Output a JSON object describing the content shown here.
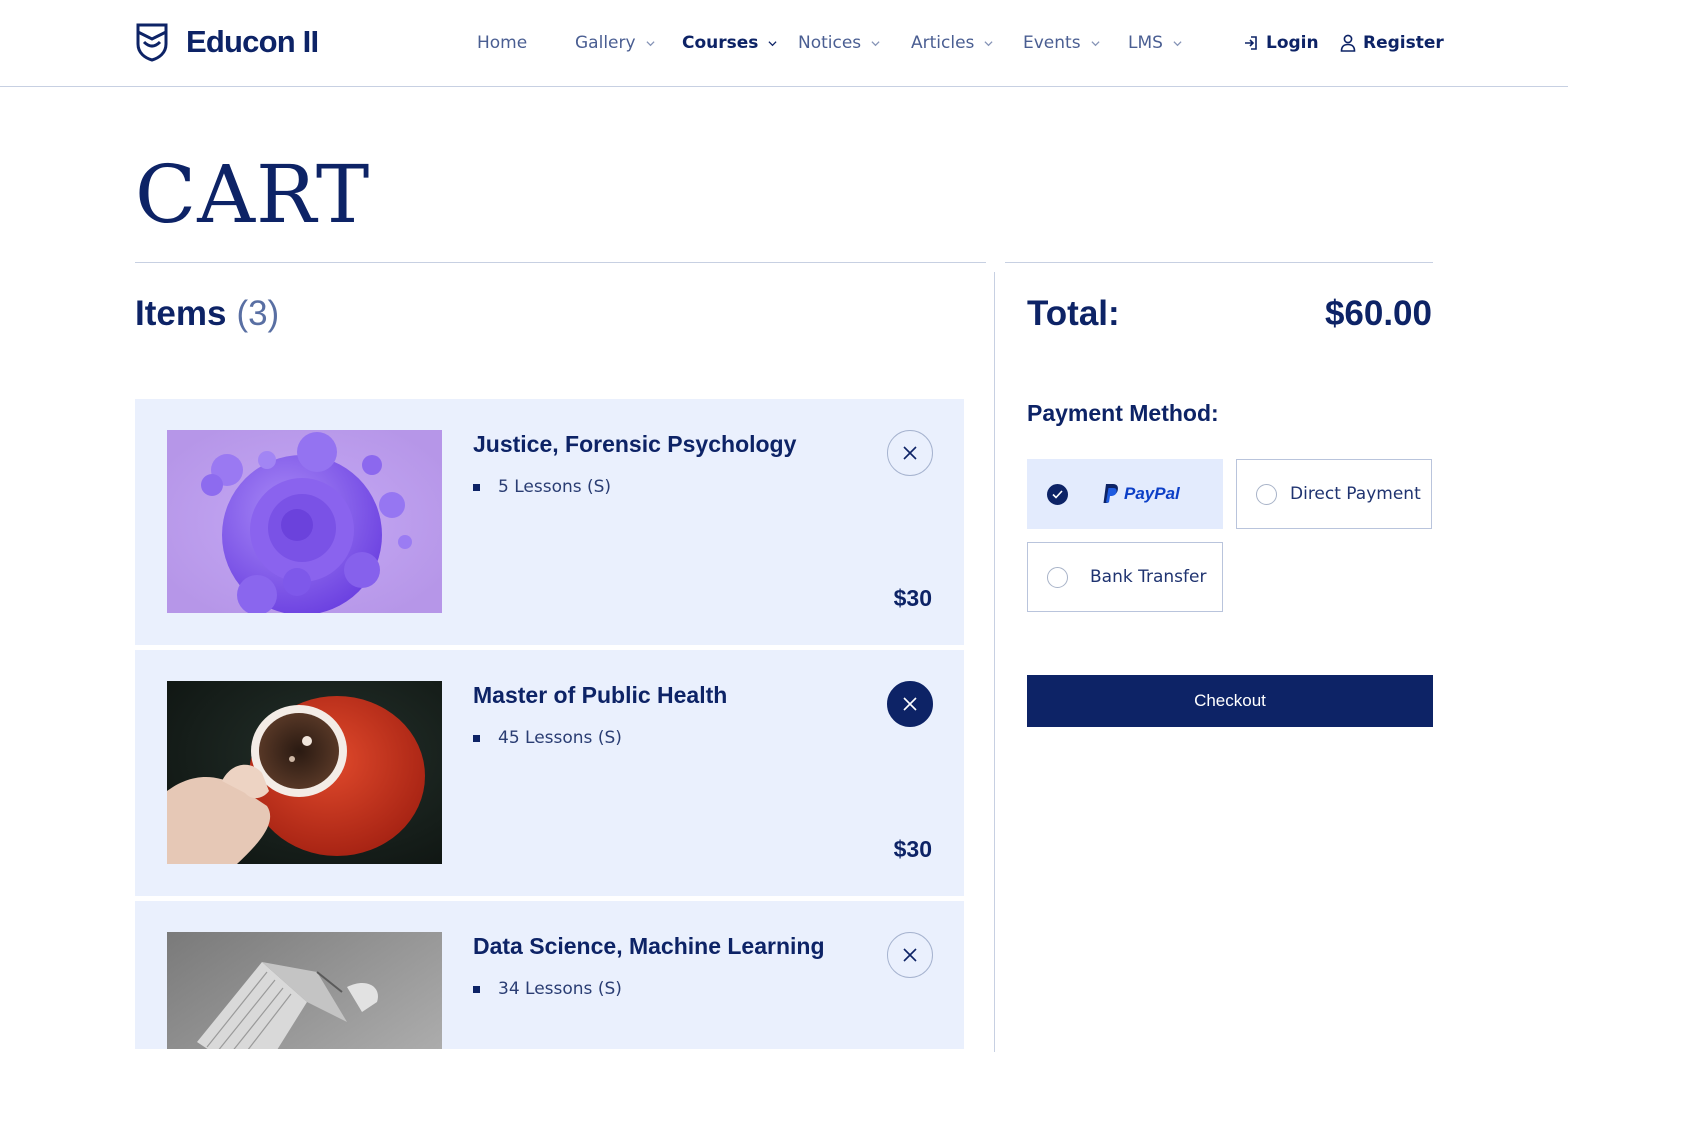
{
  "brand": {
    "name": "Educon II"
  },
  "nav": {
    "items": [
      {
        "label": "Home",
        "dropdown": false,
        "active": false
      },
      {
        "label": "Gallery",
        "dropdown": true,
        "active": false
      },
      {
        "label": "Courses",
        "dropdown": true,
        "active": true
      },
      {
        "label": "Notices",
        "dropdown": true,
        "active": false
      },
      {
        "label": "Articles",
        "dropdown": true,
        "active": false
      },
      {
        "label": "Events",
        "dropdown": true,
        "active": false
      },
      {
        "label": "LMS",
        "dropdown": true,
        "active": false
      }
    ],
    "login": "Login",
    "register": "Register"
  },
  "page": {
    "title": "CART"
  },
  "cart": {
    "heading": "Items",
    "count": "(3)",
    "items": [
      {
        "title": "Justice, Forensic Psychology",
        "meta": "5 Lessons (S)",
        "price": "$30",
        "image": "purple-abstract-sculpture"
      },
      {
        "title": "Master of Public Health",
        "meta": "45 Lessons (S)",
        "price": "$30",
        "image": "hand-holding-red-coffee-cup"
      },
      {
        "title": "Data Science, Machine Learning",
        "meta": "34 Lessons (S)",
        "price": "",
        "image": "open-book-grayscale"
      }
    ]
  },
  "summary": {
    "total_label": "Total:",
    "total_value": "$60.00",
    "payment_title": "Payment Method:",
    "methods": [
      {
        "label": "PayPal",
        "selected": true
      },
      {
        "label": "Direct Payment",
        "selected": false
      },
      {
        "label": "Bank Transfer",
        "selected": false
      }
    ],
    "checkout_label": "Checkout"
  },
  "colors": {
    "primary": "#0d2366",
    "card_bg": "#eaf0fd",
    "muted": "#596fa3",
    "paypal": "#0c3fc7"
  }
}
